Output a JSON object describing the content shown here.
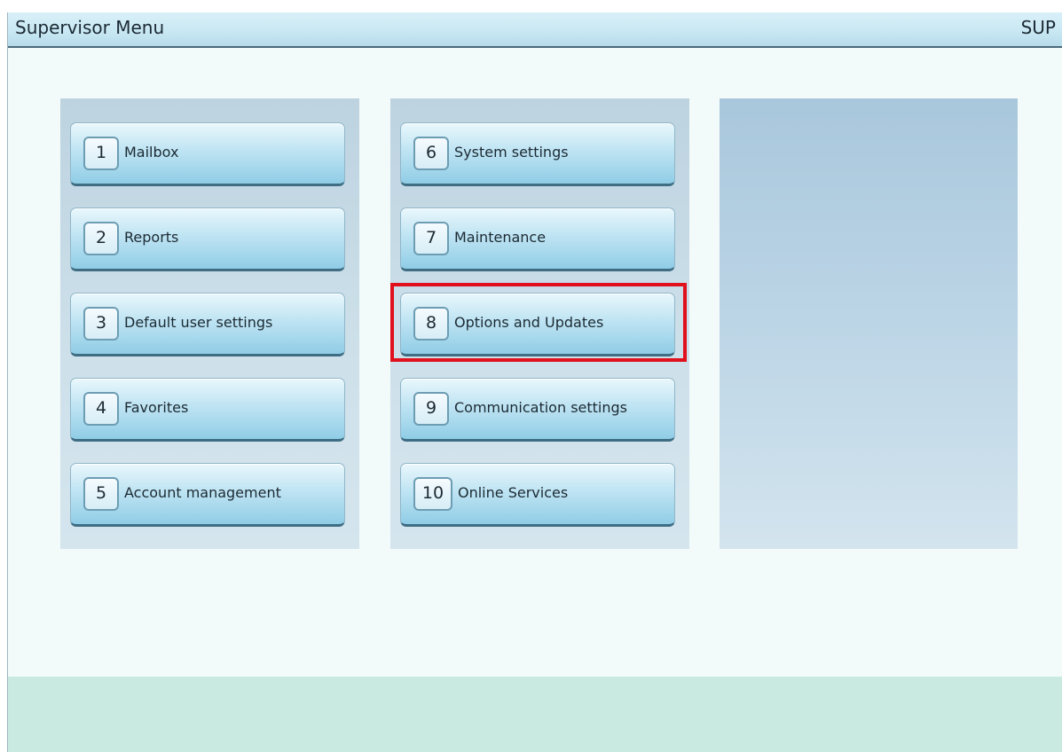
{
  "title": "Supervisor Menu",
  "user_code": "SUP",
  "menu": [
    {
      "num": "1",
      "label": "Mailbox"
    },
    {
      "num": "2",
      "label": "Reports"
    },
    {
      "num": "3",
      "label": "Default user settings"
    },
    {
      "num": "4",
      "label": "Favorites"
    },
    {
      "num": "5",
      "label": "Account management"
    },
    {
      "num": "6",
      "label": "System settings"
    },
    {
      "num": "7",
      "label": "Maintenance"
    },
    {
      "num": "8",
      "label": "Options and Updates"
    },
    {
      "num": "9",
      "label": "Communication settings"
    },
    {
      "num": "10",
      "label": "Online Services"
    }
  ],
  "highlighted_item": "Options and Updates",
  "colors": {
    "highlight": "#e0101c",
    "title_bar": "#c9e8f3",
    "footer": "#c8eae0"
  }
}
